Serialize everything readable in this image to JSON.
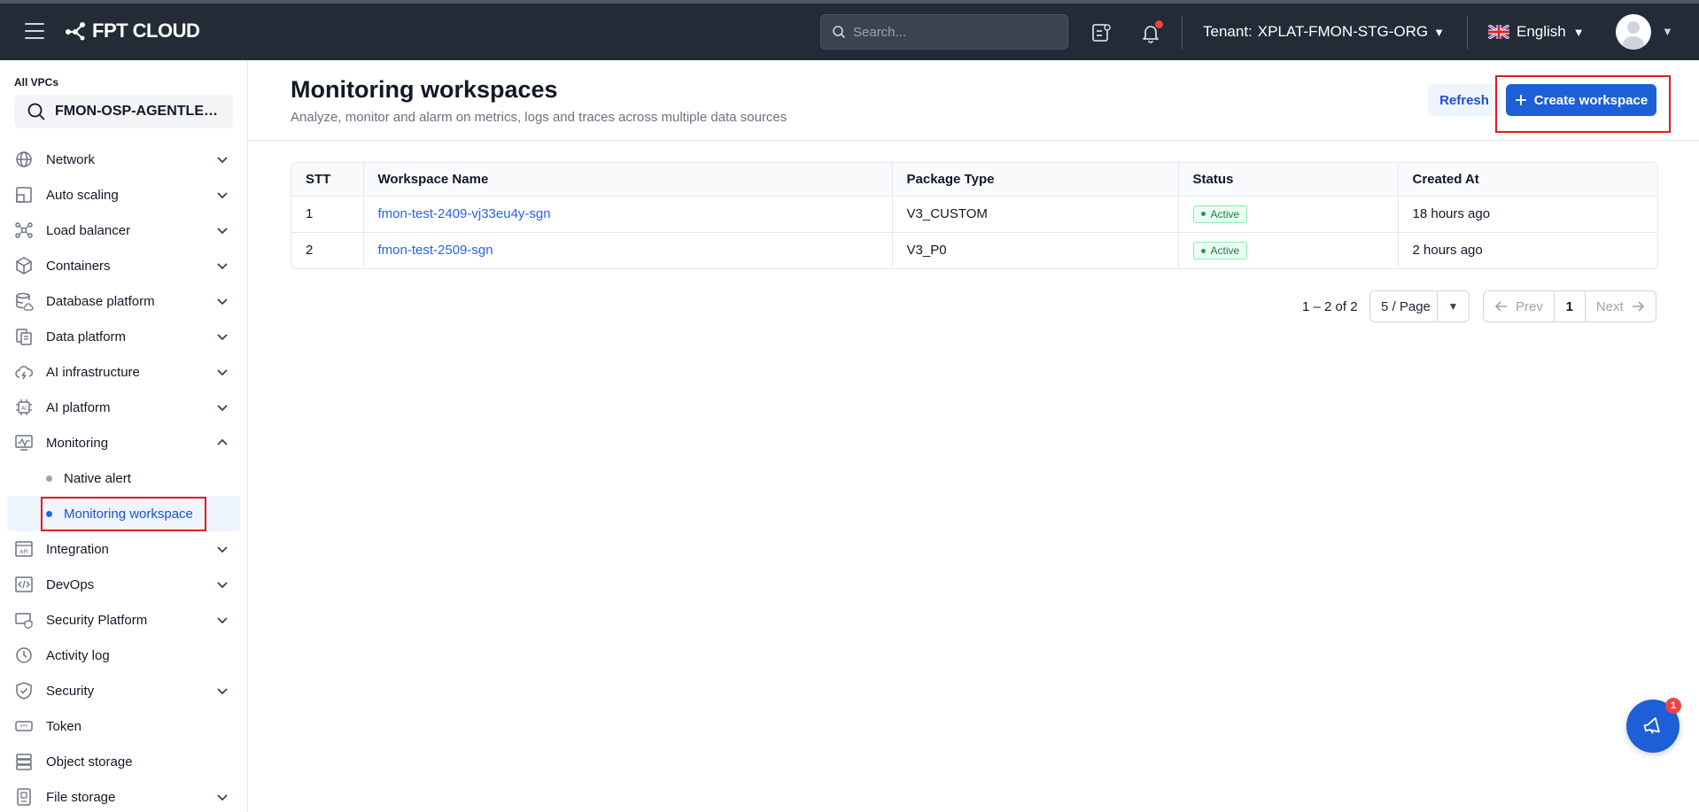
{
  "topbar": {
    "logo_text": "FPT CLOUD",
    "search_placeholder": "Search...",
    "tenant_label": "Tenant:",
    "tenant_value": "XPLAT-FMON-STG-ORG",
    "language": "English",
    "notification_dot_color": "#ef4444"
  },
  "sidebar": {
    "vpc_label": "All VPCs",
    "vpc_value": "FMON-OSP-AGENTLESS",
    "items": [
      {
        "label": "Network",
        "icon": "globe-icon",
        "expandable": true
      },
      {
        "label": "Auto scaling",
        "icon": "autoscaling-icon",
        "expandable": true
      },
      {
        "label": "Load balancer",
        "icon": "load-balancer-icon",
        "expandable": true
      },
      {
        "label": "Containers",
        "icon": "container-icon",
        "expandable": true
      },
      {
        "label": "Database platform",
        "icon": "database-icon",
        "expandable": true
      },
      {
        "label": "Data platform",
        "icon": "data-platform-icon",
        "expandable": true
      },
      {
        "label": "AI infrastructure",
        "icon": "cloud-ai-icon",
        "expandable": true
      },
      {
        "label": "AI platform",
        "icon": "ai-chip-icon",
        "expandable": true
      },
      {
        "label": "Monitoring",
        "icon": "monitoring-icon",
        "expandable": true,
        "expanded": true
      }
    ],
    "monitoring_children": [
      {
        "label": "Native alert",
        "active": false
      },
      {
        "label": "Monitoring workspace",
        "active": true
      }
    ],
    "items_after": [
      {
        "label": "Integration",
        "icon": "api-icon",
        "expandable": true
      },
      {
        "label": "DevOps",
        "icon": "devops-icon",
        "expandable": true
      },
      {
        "label": "Security Platform",
        "icon": "security-platform-icon",
        "expandable": true
      },
      {
        "label": "Activity log",
        "icon": "clock-icon",
        "expandable": false
      },
      {
        "label": "Security",
        "icon": "shield-icon",
        "expandable": true
      },
      {
        "label": "Token",
        "icon": "token-icon",
        "expandable": false
      },
      {
        "label": "Object storage",
        "icon": "object-storage-icon",
        "expandable": false
      },
      {
        "label": "File storage",
        "icon": "file-storage-icon",
        "expandable": true
      }
    ]
  },
  "main": {
    "title": "Monitoring workspaces",
    "subtitle": "Analyze, monitor and alarm on metrics, logs and traces across multiple data sources",
    "refresh_label": "Refresh",
    "create_label": "Create workspace",
    "table": {
      "headers": [
        "STT",
        "Workspace Name",
        "Package Type",
        "Status",
        "Created At"
      ],
      "rows": [
        {
          "stt": "1",
          "name": "fmon-test-2409-vj33eu4y-sgn",
          "package": "V3_CUSTOM",
          "status": "Active",
          "created": "18 hours ago"
        },
        {
          "stt": "2",
          "name": "fmon-test-2509-sgn",
          "package": "V3_P0",
          "status": "Active",
          "created": "2 hours ago"
        }
      ]
    },
    "pagination": {
      "info": "1 – 2 of 2",
      "page_size": "5 / Page",
      "prev": "Prev",
      "current": "1",
      "next": "Next"
    }
  },
  "fab": {
    "badge": "1"
  },
  "colors": {
    "accent": "#1d5fd6",
    "highlight": "#e11d1d",
    "active_status": "#15803d"
  }
}
